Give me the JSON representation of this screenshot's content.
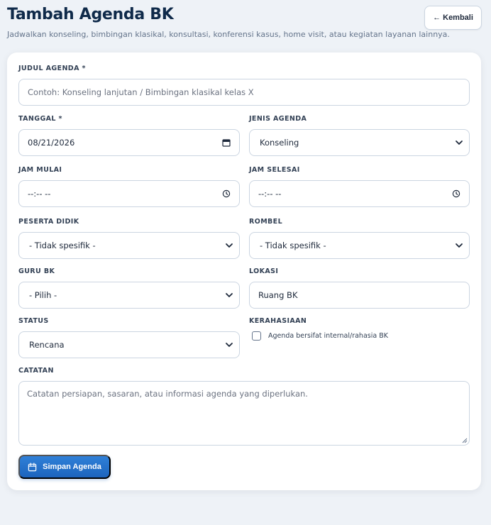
{
  "header": {
    "title": "Tambah Agenda BK",
    "subtitle": "Jadwalkan konseling, bimbingan klasikal, konsultasi, konferensi kasus, home visit, atau kegiatan layanan lainnya.",
    "back_label": "← Kembali"
  },
  "form": {
    "judul": {
      "label": "JUDUL AGENDA *",
      "placeholder": "Contoh: Konseling lanjutan / Bimbingan klasikal kelas X"
    },
    "tanggal": {
      "label": "TANGGAL *",
      "value": "08/21/2026"
    },
    "jenis": {
      "label": "JENIS AGENDA",
      "value": "Konseling"
    },
    "jam_mulai": {
      "label": "JAM MULAI",
      "value": "--:-- --"
    },
    "jam_selesai": {
      "label": "JAM SELESAI",
      "value": "--:-- --"
    },
    "peserta": {
      "label": "PESERTA DIDIK",
      "value": "- Tidak spesifik -"
    },
    "rombel": {
      "label": "ROMBEL",
      "value": "- Tidak spesifik -"
    },
    "guru": {
      "label": "GURU BK",
      "value": "- Pilih -"
    },
    "lokasi": {
      "label": "LOKASI",
      "value": "Ruang BK"
    },
    "status": {
      "label": "STATUS",
      "value": "Rencana"
    },
    "kerahasiaan": {
      "label": "KERAHASIAAN",
      "checkbox_label": "Agenda bersifat internal/rahasia BK",
      "checked": false
    },
    "catatan": {
      "label": "CATATAN",
      "placeholder": "Catatan persiapan, sasaran, atau informasi agenda yang diperlukan."
    },
    "save_label": "Simpan Agenda"
  },
  "icons": {
    "date": "calendar-icon",
    "time": "clock-icon",
    "select": "chevron-down-icon",
    "save": "calendar-icon"
  },
  "colors": {
    "primary": "#1c64bd",
    "title": "#0f2a4a",
    "background": "#eef2f7"
  }
}
